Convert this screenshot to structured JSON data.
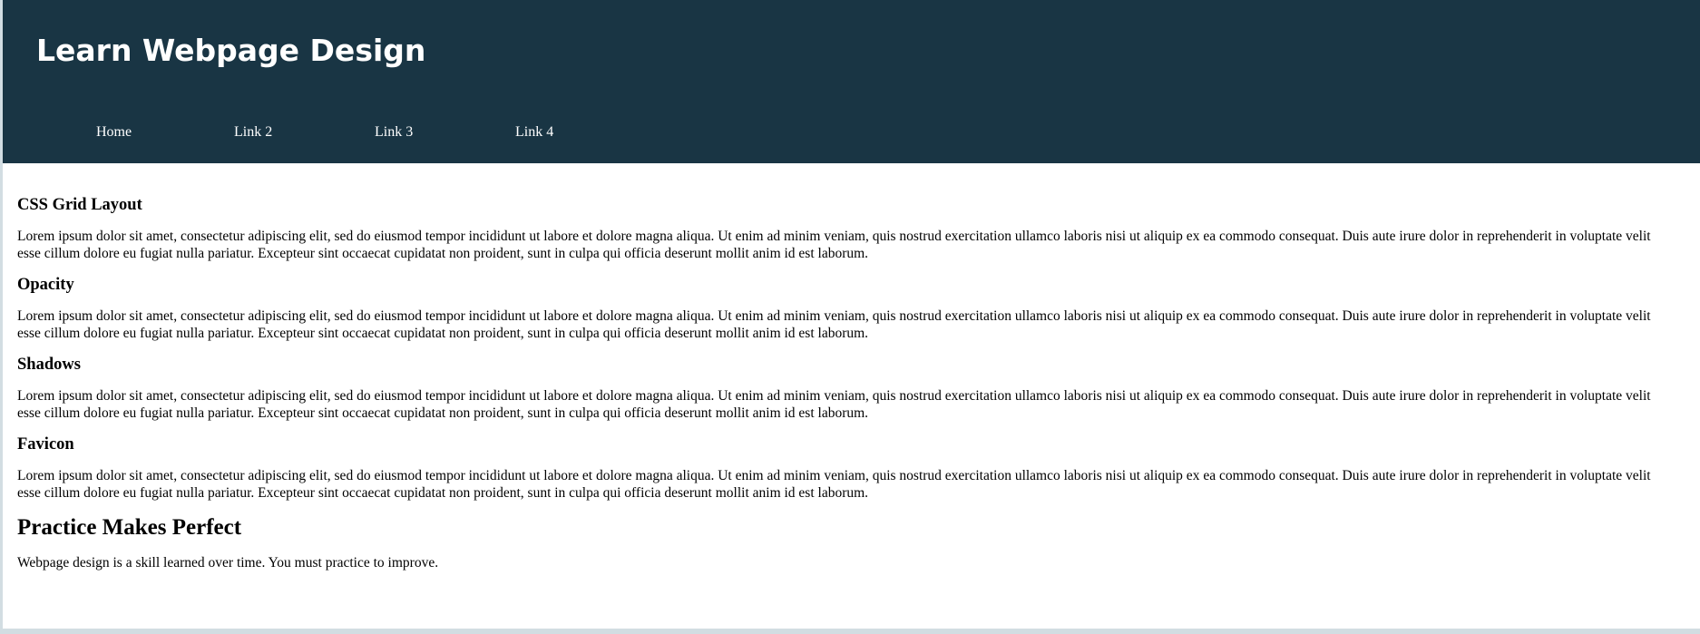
{
  "header": {
    "title": "Learn Webpage Design"
  },
  "nav": {
    "items": [
      {
        "label": "Home"
      },
      {
        "label": "Link 2"
      },
      {
        "label": "Link 3"
      },
      {
        "label": "Link 4"
      }
    ]
  },
  "sections": [
    {
      "title": "CSS Grid Layout",
      "text": "Lorem ipsum dolor sit amet, consectetur adipiscing elit, sed do eiusmod tempor incididunt ut labore et dolore magna aliqua. Ut enim ad minim veniam, quis nostrud exercitation ullamco laboris nisi ut aliquip ex ea commodo consequat. Duis aute irure dolor in reprehenderit in voluptate velit esse cillum dolore eu fugiat nulla pariatur. Excepteur sint occaecat cupidatat non proident, sunt in culpa qui officia deserunt mollit anim id est laborum."
    },
    {
      "title": "Opacity",
      "text": "Lorem ipsum dolor sit amet, consectetur adipiscing elit, sed do eiusmod tempor incididunt ut labore et dolore magna aliqua. Ut enim ad minim veniam, quis nostrud exercitation ullamco laboris nisi ut aliquip ex ea commodo consequat. Duis aute irure dolor in reprehenderit in voluptate velit esse cillum dolore eu fugiat nulla pariatur. Excepteur sint occaecat cupidatat non proident, sunt in culpa qui officia deserunt mollit anim id est laborum."
    },
    {
      "title": "Shadows",
      "text": "Lorem ipsum dolor sit amet, consectetur adipiscing elit, sed do eiusmod tempor incididunt ut labore et dolore magna aliqua. Ut enim ad minim veniam, quis nostrud exercitation ullamco laboris nisi ut aliquip ex ea commodo consequat. Duis aute irure dolor in reprehenderit in voluptate velit esse cillum dolore eu fugiat nulla pariatur. Excepteur sint occaecat cupidatat non proident, sunt in culpa qui officia deserunt mollit anim id est laborum."
    },
    {
      "title": "Favicon",
      "text": "Lorem ipsum dolor sit amet, consectetur adipiscing elit, sed do eiusmod tempor incididunt ut labore et dolore magna aliqua. Ut enim ad minim veniam, quis nostrud exercitation ullamco laboris nisi ut aliquip ex ea commodo consequat. Duis aute irure dolor in reprehenderit in voluptate velit esse cillum dolore eu fugiat nulla pariatur. Excepteur sint occaecat cupidatat non proident, sunt in culpa qui officia deserunt mollit anim id est laborum."
    }
  ],
  "closing": {
    "title": "Practice Makes Perfect",
    "text": "Webpage design is a skill learned over time. You must practice to improve."
  },
  "colors": {
    "header_background": "#193544",
    "header_text": "#ffffff",
    "page_background": "#ffffff",
    "page_border": "#d2dde2"
  }
}
